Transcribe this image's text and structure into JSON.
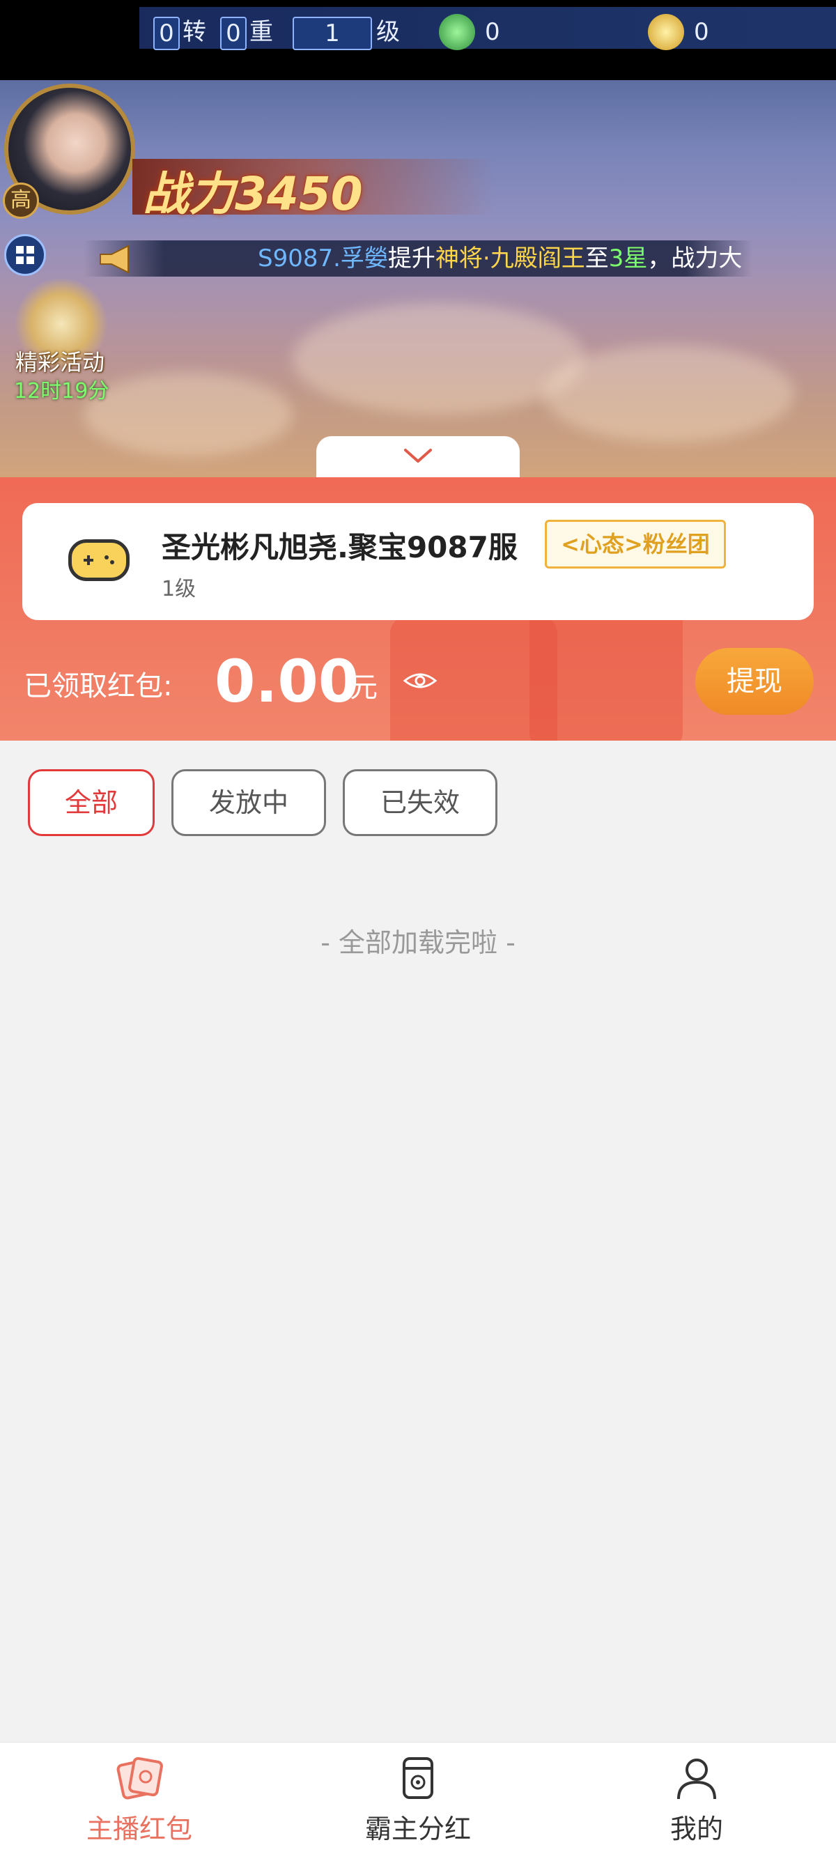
{
  "game": {
    "rebirth_count": "0",
    "rebirth_label": "转",
    "stage_count": "0",
    "stage_label": "重",
    "level_value": "1",
    "level_label": "级",
    "jade_count": "0",
    "gold_count": "0",
    "badge": "高",
    "power_label": "战力3450",
    "marquee": {
      "server": "S9087.",
      "player": "孚嫈",
      "action": "提升",
      "item": "神将·九殿阎王",
      "to": "至",
      "stars": "3星",
      "tail": "，战力大"
    },
    "activity_label": "精彩活动",
    "activity_timer": "12时19分"
  },
  "server_card": {
    "name": "圣光彬凡旭尧.聚宝9087服",
    "level": "1级",
    "fan_tag": "<心态>粉丝团"
  },
  "redpacket": {
    "received_label": "已领取红包:",
    "amount": "0.00",
    "currency": "元",
    "withdraw_label": "提现"
  },
  "filters": {
    "all": "全部",
    "issuing": "发放中",
    "expired": "已失效",
    "active": "all"
  },
  "list_end_text": "- 全部加载完啦 -",
  "nav": {
    "items": [
      {
        "label": "主播红包",
        "icon": "red-packet-icon",
        "active": true
      },
      {
        "label": "霸主分红",
        "icon": "dividend-icon",
        "active": false
      },
      {
        "label": "我的",
        "icon": "user-icon",
        "active": false
      }
    ]
  },
  "colors": {
    "accent_red": "#e23a3a",
    "header_orange": "#f06a55",
    "withdraw_orange": "#f08a26",
    "nav_active": "#e8725f"
  }
}
